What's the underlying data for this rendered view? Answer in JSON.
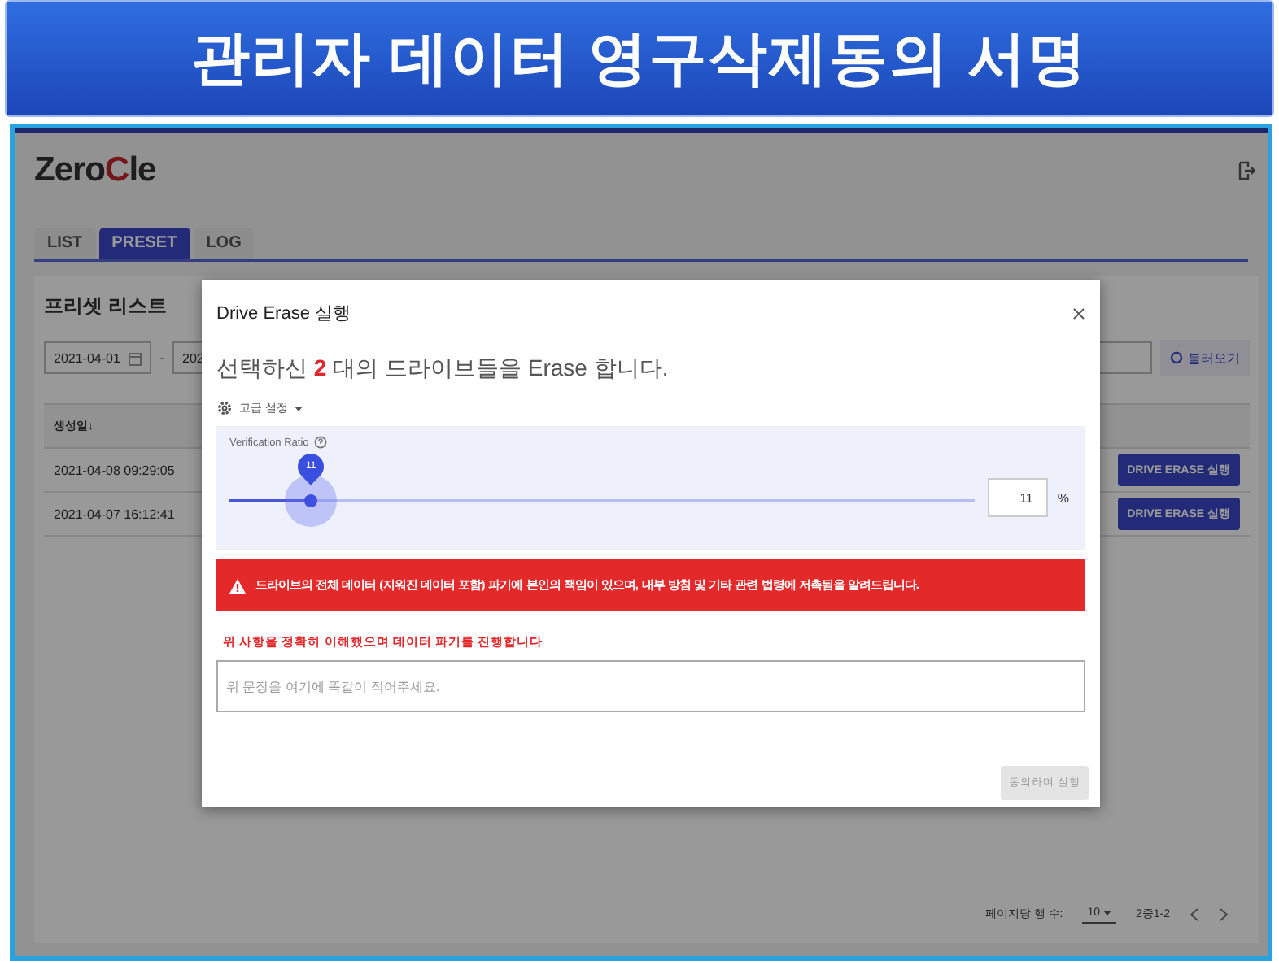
{
  "banner": {
    "title": "관리자 데이터 영구삭제동의 서명"
  },
  "app": {
    "logo_prefix": "Zero",
    "logo_accent": "C",
    "logo_suffix": "le",
    "tabs": [
      {
        "label": "LIST",
        "selected": false
      },
      {
        "label": "PRESET",
        "selected": true
      },
      {
        "label": "LOG",
        "selected": false
      }
    ],
    "section_title": "프리셋 리스트",
    "date_from": "2021-04-01",
    "date_separator": "-",
    "date_to": "202",
    "load_button": "불러오기",
    "table": {
      "columns": [
        "생성일↓"
      ],
      "rows": [
        {
          "created": "2021-04-08 09:29:05",
          "action": "DRIVE ERASE 실행"
        },
        {
          "created": "2021-04-07 16:12:41",
          "action": "DRIVE ERASE 실행"
        }
      ]
    },
    "pagination": {
      "rows_per_page_label": "페이지당 행 수:",
      "rows_per_page": "10",
      "range": "2중1-2"
    }
  },
  "modal": {
    "title": "Drive Erase 실행",
    "message_prefix": "선택하신",
    "count": "2",
    "message_suffix": "대의 드라이브들을 Erase 합니다.",
    "advanced": "고급 설정",
    "ratio_label": "Verification Ratio",
    "slider": {
      "level": 0.11,
      "bubble": "11"
    },
    "ratio_value": "11",
    "unit": "%",
    "warning": "드라이브의 전체 데이터 (지워진 데이터 포함) 파기에 본인의 책임이 있으며, 내부 방침 및 기타 관련 법령에 저촉됨을 알려드립니다.",
    "confirm_prompt": "위 사항을 정확히 이해했으며 데이터 파기를 진행합니다",
    "confirm_field": {
      "placeholder": "위 문장을 여기에 똑같이 적어주세요."
    },
    "submit": {
      "label": "동의하며 실행",
      "disabled": true
    }
  }
}
